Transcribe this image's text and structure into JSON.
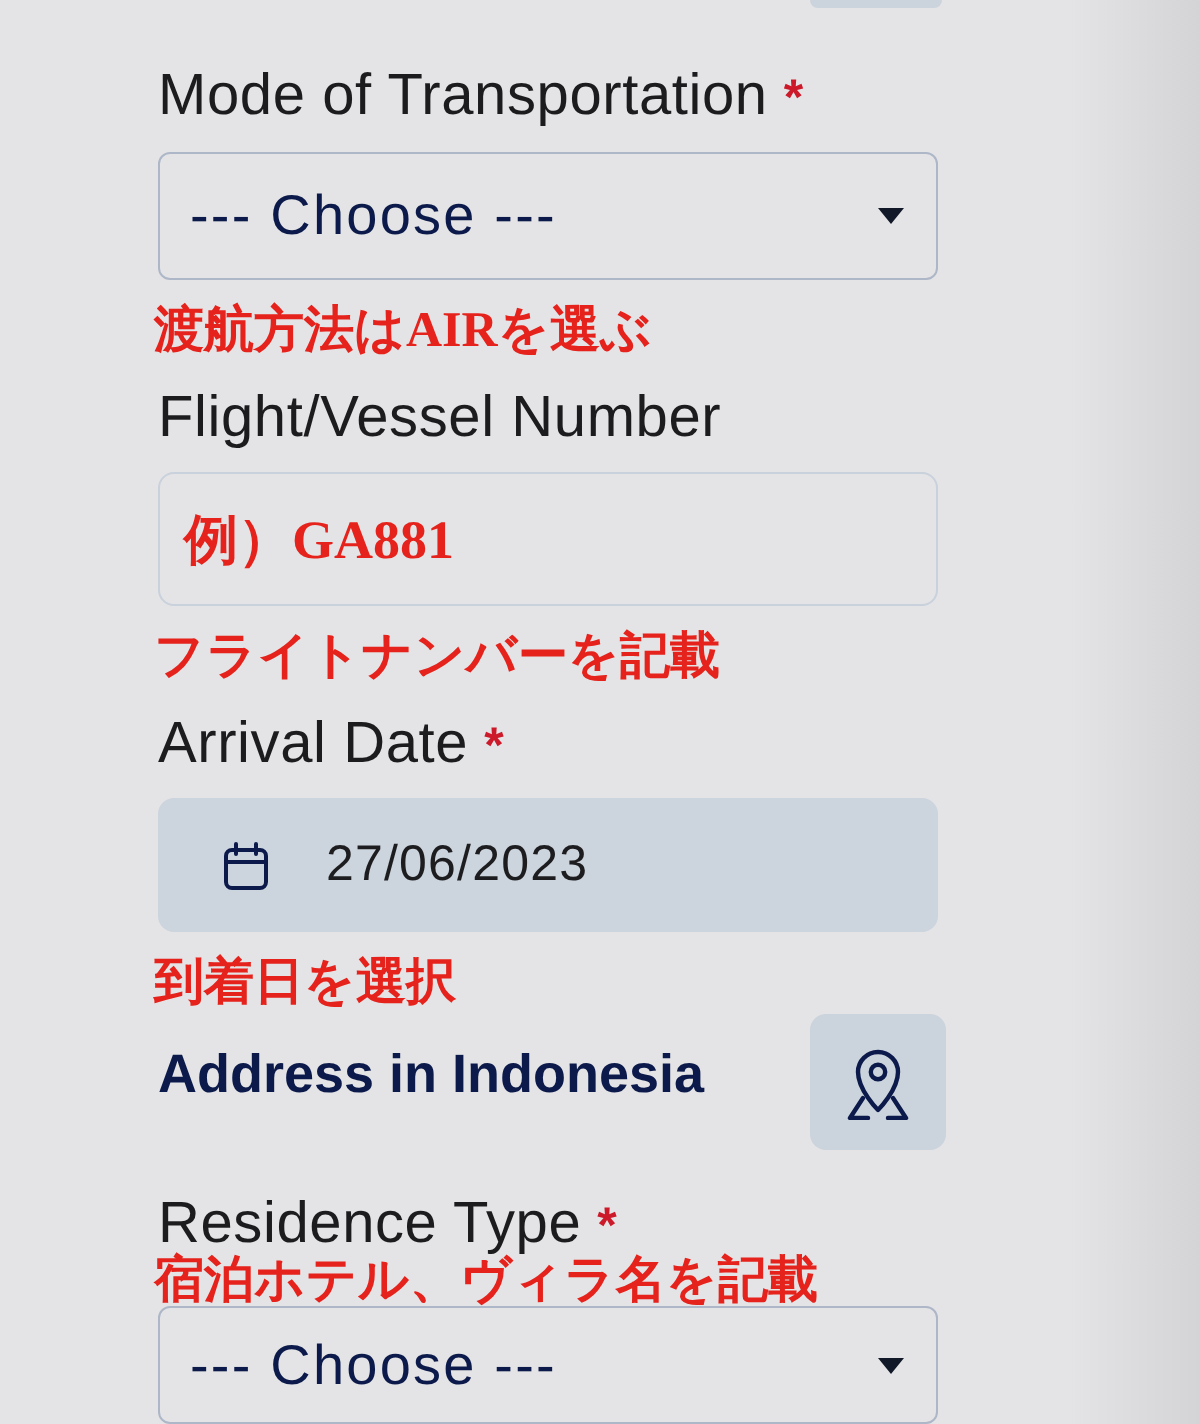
{
  "fields": [
    {
      "kind": "select",
      "label": "Mode of Transportation",
      "required_mark": "*",
      "value": "--- Choose ---",
      "note": "渡航方法はAIRを選ぶ",
      "note_above_field": false
    },
    {
      "kind": "text",
      "label": "Flight/Vessel Number",
      "note_in_field": "例）GA881",
      "note": "フライトナンバーを記載",
      "note_above_field": false
    },
    {
      "kind": "date",
      "label": "Arrival Date",
      "required_mark": "*",
      "value": "27/06/2023",
      "note": "到着日を選択",
      "note_above_field": false
    },
    {
      "kind": "section",
      "title": "Address in Indonesia"
    },
    {
      "kind": "select",
      "label": "Residence Type",
      "required_mark": "*",
      "value": "--- Choose ---",
      "note": "宿泊ホテル、ヴィラ名を記載",
      "note_above_field": true
    }
  ]
}
